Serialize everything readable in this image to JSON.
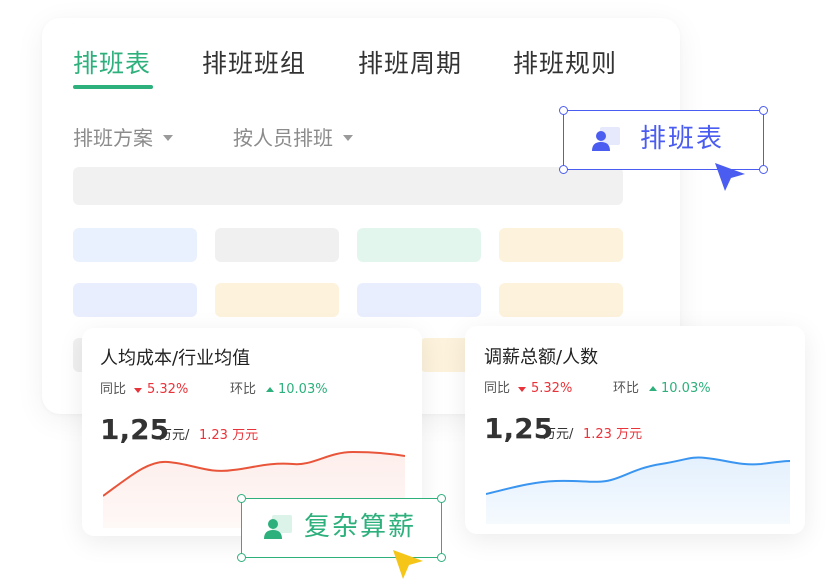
{
  "tabs": [
    {
      "label": "排班表",
      "active": true
    },
    {
      "label": "排班班组",
      "active": false
    },
    {
      "label": "排班周期",
      "active": false
    },
    {
      "label": "排班规则",
      "active": false
    }
  ],
  "filters": {
    "scheme_label": "排班方案",
    "person_label": "按人员排班"
  },
  "colors": {
    "accent_green": "#2db07c",
    "accent_blue": "#4b5cf0",
    "up_red": "#e8333a",
    "line_red": "#e8553a",
    "line_blue": "#3a95f0",
    "cursor_yellow": "#f5c518"
  },
  "cards": [
    {
      "title": "人均成本/行业均值",
      "yoy_label": "同比",
      "yoy_value": "5.32%",
      "mom_label": "环比",
      "mom_value": "10.03%",
      "main_value": "1,25",
      "main_unit": "万元/",
      "compare_value": "1.23 万元"
    },
    {
      "title": "调薪总额/人数",
      "yoy_label": "同比",
      "yoy_value": "5.32%",
      "mom_label": "环比",
      "mom_value": "10.03%",
      "main_value": "1,25",
      "main_unit": "万元/",
      "compare_value": "1.23 万元"
    }
  ],
  "badges": {
    "schedule_label": "排班表",
    "salary_label": "复杂算薪"
  },
  "icons": [
    "user-icon",
    "cursor-icon",
    "caret-down-icon",
    "arrow-down-icon",
    "arrow-up-icon"
  ]
}
